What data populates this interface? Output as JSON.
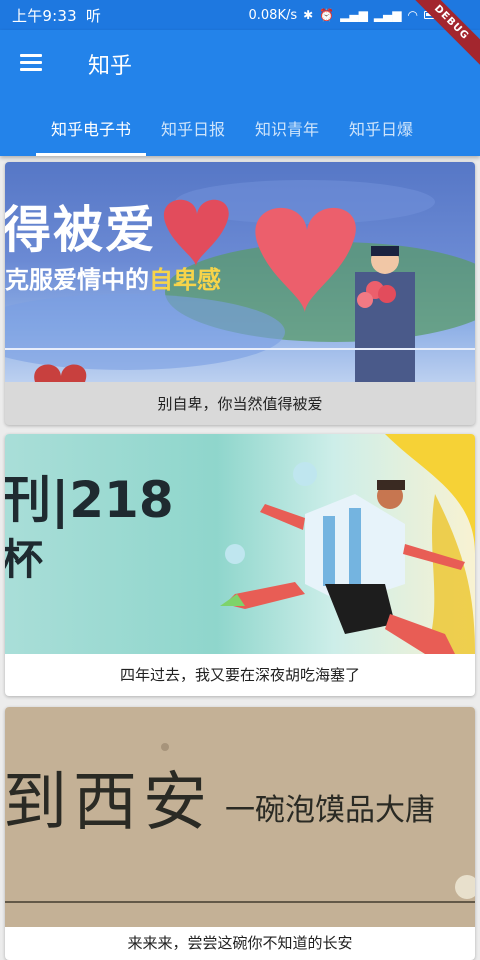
{
  "status_bar": {
    "time": "上午9:33",
    "carrier_icon": "听",
    "speed": "0.08K/s",
    "icons": [
      "bluetooth-icon",
      "alarm-icon",
      "signal-icon",
      "signal-icon",
      "wifi-icon",
      "battery-icon"
    ]
  },
  "debug_banner": "DEBUG",
  "app_bar": {
    "title": "知乎",
    "menu_icon": "hamburger-menu-icon"
  },
  "tabs": [
    {
      "label": "知乎电子书",
      "active": true
    },
    {
      "label": "知乎日报",
      "active": false
    },
    {
      "label": "知识青年",
      "active": false
    },
    {
      "label": "知乎日爆",
      "active": false
    }
  ],
  "cards": [
    {
      "banner_title": "得被爱",
      "banner_subtitle_pre": "克服爱情中的",
      "banner_subtitle_hl": "自卑感",
      "caption": "别自卑，你当然值得被爱"
    },
    {
      "banner_title": "刊|218",
      "banner_title_line2": "杯",
      "caption": "四年过去，我又要在深夜胡吃海塞了"
    },
    {
      "banner_title": "到西安",
      "banner_subtitle": "一碗泡馍品大唐",
      "caption": "来来来，尝尝这碗你不知道的长安"
    }
  ],
  "colors": {
    "primary": "#2383ea",
    "status_bar": "#1e78e0",
    "debug": "#a3262e"
  }
}
